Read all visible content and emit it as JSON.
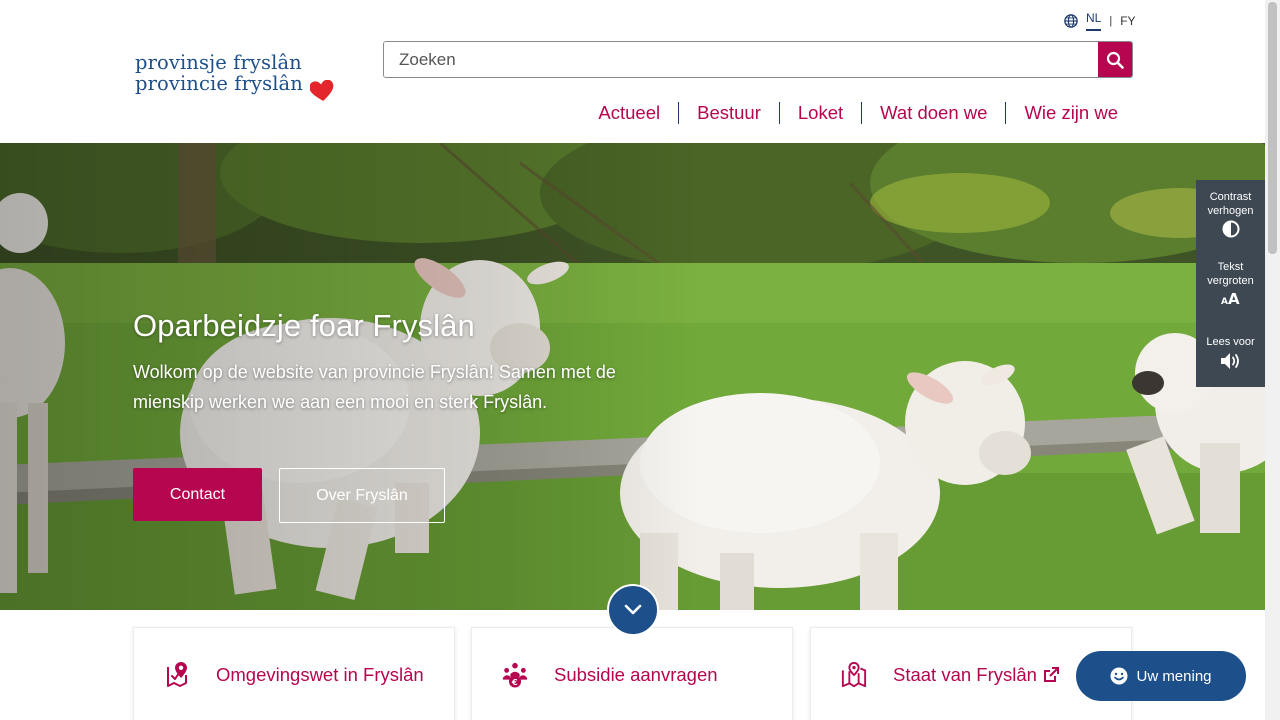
{
  "language": {
    "options": [
      "NL",
      "FY"
    ],
    "selected": "NL"
  },
  "logo": {
    "line1": "provinsje fryslân",
    "line2": "provincie fryslân"
  },
  "search": {
    "placeholder": "Zoeken"
  },
  "nav": {
    "items": [
      "Actueel",
      "Bestuur",
      "Loket",
      "Wat doen we",
      "Wie zijn we"
    ]
  },
  "hero": {
    "title": "Oparbeidzje foar Fryslân",
    "text": "Wolkom op de website van provincie Fryslân! Samen met de mienskip werken we aan een mooi en sterk Fryslân.",
    "primary_button": "Contact",
    "secondary_button": "Over Fryslân"
  },
  "accessibility": {
    "contrast": "Contrast verhogen",
    "text_size": "Tekst vergroten",
    "read_aloud": "Lees voor"
  },
  "cards": [
    {
      "label": "Omgevingswet in Fryslân",
      "icon": "map-pin-check-icon"
    },
    {
      "label": "Subsidie aanvragen",
      "icon": "people-euro-icon"
    },
    {
      "label": "Staat van Fryslân",
      "icon": "map-book-icon",
      "external": true
    }
  ],
  "feedback": {
    "label": "Uw mening"
  },
  "colors": {
    "accent": "#b5064f",
    "navy": "#1d4f8a",
    "panel": "#3d4852"
  }
}
